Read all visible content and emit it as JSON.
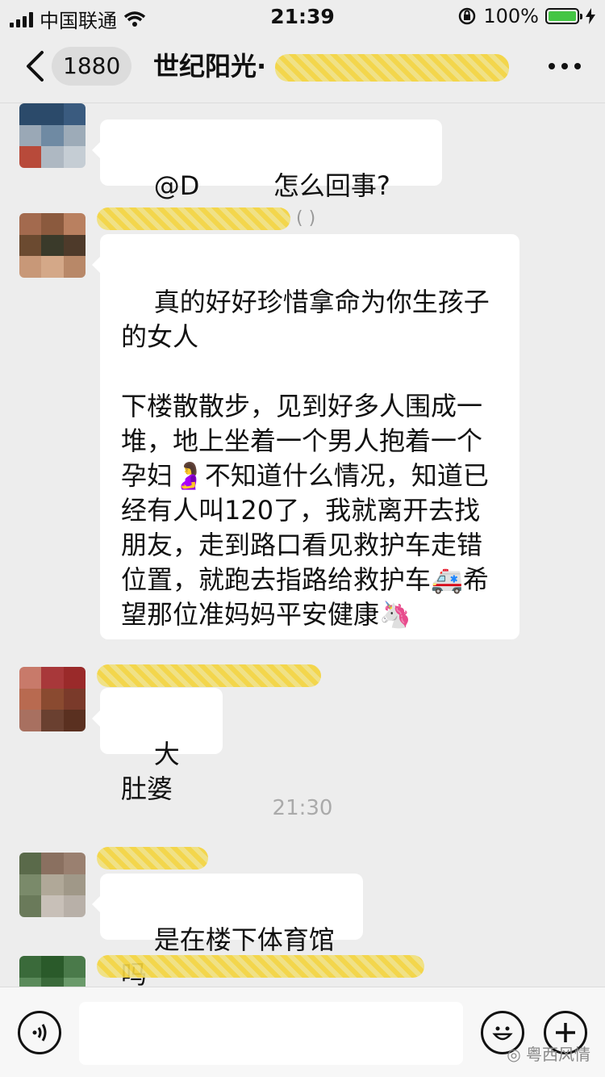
{
  "status_bar": {
    "carrier": "中国联通",
    "time": "21:39",
    "battery": "100%"
  },
  "header": {
    "back_count": "1880",
    "title": "世纪阳光·"
  },
  "messages": [
    {
      "text": "@D         怎么回事?"
    },
    {
      "sender": "(             )",
      "text": "真的好好珍惜拿命为你生孩子的女人\n\n下楼散散步，见到好多人围成一堆，地上坐着一个男人抱着一个孕妇🤰不知道什么情况，知道已经有人叫120了，我就离开去找朋友，走到路口看见救护车走错位置，就跑去指路给救护车🚑希望那位准妈妈平安健康🦄"
    },
    {
      "text": "大肚婆"
    },
    {
      "time": "21:30"
    },
    {
      "text": "是在楼下体育馆吗"
    }
  ],
  "input": {
    "placeholder": ""
  },
  "watermark": "粤西风情"
}
